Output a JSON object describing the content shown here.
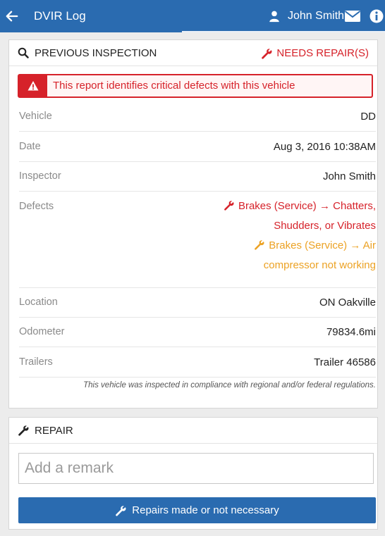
{
  "header": {
    "title": "DVIR Log",
    "user_name": "John Smith",
    "icons": {
      "back": "arrow-left-icon",
      "user": "user-icon",
      "mail": "envelope-icon",
      "info": "info-icon"
    },
    "colors": {
      "bar": "#2a6bb0",
      "text": "#ffffff"
    }
  },
  "inspection": {
    "section_title": "PREVIOUS INSPECTION",
    "status_label": "NEEDS REPAIR(S)",
    "alert_text": "This report identifies critical defects with this vehicle",
    "fields": [
      {
        "label": "Vehicle",
        "value": "DD"
      },
      {
        "label": "Date",
        "value": "Aug 3, 2016 10:38AM"
      },
      {
        "label": "Inspector",
        "value": "John Smith"
      }
    ],
    "defects_label": "Defects",
    "defects": [
      {
        "severity": "critical",
        "color": "#d6222a",
        "line1": "Brakes (Service) → Chatters,",
        "line2": "Shudders, or Vibrates"
      },
      {
        "severity": "minor",
        "color": "#eca224",
        "line1": "Brakes (Service) → Air",
        "line2": "compressor not working"
      }
    ],
    "fields_after": [
      {
        "label": "Location",
        "value": "ON Oakville"
      },
      {
        "label": "Odometer",
        "value": "79834.6mi"
      },
      {
        "label": "Trailers",
        "value": "Trailer 46586"
      }
    ],
    "compliance_note": "This vehicle was inspected in compliance with regional and/or federal regulations.",
    "colors": {
      "danger": "#d6222a",
      "warning": "#eca224"
    }
  },
  "repair": {
    "section_title": "REPAIR",
    "remark_placeholder": "Add a remark",
    "remark_value": "",
    "button_label": "Repairs made or not necessary"
  }
}
